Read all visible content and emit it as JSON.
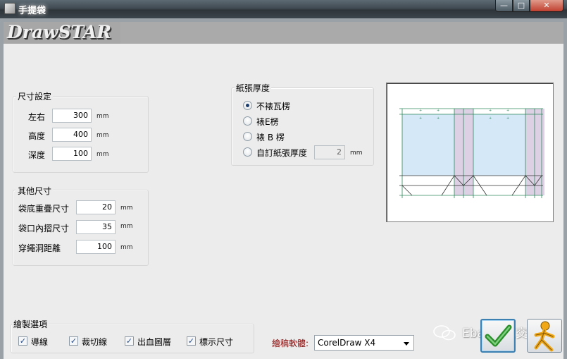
{
  "window": {
    "title": "手提袋",
    "min_glyph": "—",
    "max_glyph": "□",
    "close_glyph": "✕"
  },
  "logo": {
    "text": "DrawSTAR"
  },
  "size_group": {
    "title": "尺寸設定",
    "fields": [
      {
        "label": "左右",
        "value": "300",
        "unit": "mm"
      },
      {
        "label": "高度",
        "value": "400",
        "unit": "mm"
      },
      {
        "label": "深度",
        "value": "100",
        "unit": "mm"
      }
    ]
  },
  "other_group": {
    "title": "其他尺寸",
    "fields": [
      {
        "label": "袋底重疊尺寸",
        "value": "20",
        "unit": "mm"
      },
      {
        "label": "袋口內摺尺寸",
        "value": "35",
        "unit": "mm"
      },
      {
        "label": "穿繩洞距離",
        "value": "100",
        "unit": "mm"
      }
    ]
  },
  "paper_group": {
    "title": "紙張厚度",
    "options": [
      {
        "label": "不裱瓦楞",
        "checked": true
      },
      {
        "label": "裱E楞",
        "checked": false
      },
      {
        "label": "裱 B 楞",
        "checked": false
      },
      {
        "label": "自訂紙張厚度",
        "checked": false
      }
    ],
    "custom_value": "2",
    "custom_unit": "mm"
  },
  "draw_options": {
    "title": "繪製選項",
    "checkboxes": [
      {
        "label": "導線",
        "checked": true
      },
      {
        "label": "裁切線",
        "checked": true
      },
      {
        "label": "出血圖層",
        "checked": true
      },
      {
        "label": "標示尺寸",
        "checked": true
      }
    ]
  },
  "software": {
    "label": "繪稿軟體:",
    "selected": "CorelDraw X4",
    "label_color": "#8b0000"
  },
  "watermark": {
    "text": "Ebay賣家交流"
  },
  "icons": {
    "ok": "checkmark-icon",
    "cancel": "running-man-icon"
  }
}
